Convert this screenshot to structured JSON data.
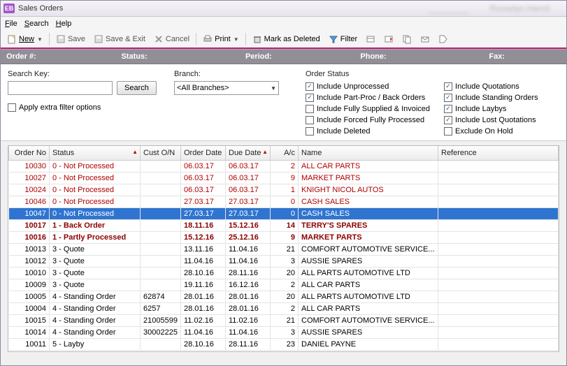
{
  "title": "Sales Orders",
  "blurred1": "________",
  "blurred2": "Russelyn Harrol",
  "menu": {
    "file": "File",
    "search": "Search",
    "help": "Help"
  },
  "toolbar": {
    "new": "New",
    "save": "Save",
    "saveexit": "Save & Exit",
    "cancel": "Cancel",
    "print": "Print",
    "markdel": "Mark as Deleted",
    "filter": "Filter"
  },
  "infobar": {
    "order": "Order #:",
    "status": "Status:",
    "period": "Period:",
    "phone": "Phone:",
    "fax": "Fax:"
  },
  "filters": {
    "searchkey_lbl": "Search Key:",
    "search_btn": "Search",
    "extra_lbl": "Apply extra filter options",
    "branch_lbl": "Branch:",
    "branch_val": "<All Branches>",
    "os_lbl": "Order Status",
    "os": [
      {
        "label": "Include Unprocessed",
        "checked": true
      },
      {
        "label": "Include Part-Proc / Back Orders",
        "checked": true
      },
      {
        "label": "Include Fully Supplied & Invoiced",
        "checked": false
      },
      {
        "label": "Include Forced Fully Processed",
        "checked": false
      },
      {
        "label": "Include Deleted",
        "checked": false
      }
    ],
    "os2": [
      {
        "label": "Include Quotations",
        "checked": true
      },
      {
        "label": "Include Standing Orders",
        "checked": true
      },
      {
        "label": "Include Laybys",
        "checked": true
      },
      {
        "label": "Include Lost Quotations",
        "checked": true
      },
      {
        "label": "Exclude On Hold",
        "checked": false
      }
    ]
  },
  "cols": {
    "orderno": "Order No",
    "status": "Status",
    "con": "Cust O/N",
    "od": "Order Date",
    "dd": "Due Date",
    "ac": "A/c",
    "name": "Name",
    "ref": "Reference"
  },
  "rows": [
    {
      "no": "10030",
      "st": "0 - Not Processed",
      "con": "",
      "od": "06.03.17",
      "dd": "06.03.17",
      "ac": "2",
      "nm": "ALL CAR PARTS",
      "cls": "red"
    },
    {
      "no": "10027",
      "st": "0 - Not Processed",
      "con": "",
      "od": "06.03.17",
      "dd": "06.03.17",
      "ac": "9",
      "nm": "MARKET PARTS",
      "cls": "red"
    },
    {
      "no": "10024",
      "st": "0 - Not Processed",
      "con": "",
      "od": "06.03.17",
      "dd": "06.03.17",
      "ac": "1",
      "nm": "KNIGHT NICOL AUTOS",
      "cls": "red"
    },
    {
      "no": "10046",
      "st": "0 - Not Processed",
      "con": "",
      "od": "27.03.17",
      "dd": "27.03.17",
      "ac": "0",
      "nm": "CASH SALES",
      "cls": "red"
    },
    {
      "no": "10047",
      "st": "0 - Not Processed",
      "con": "",
      "od": "27.03.17",
      "dd": "27.03.17",
      "ac": "0",
      "nm": "CASH SALES",
      "cls": "red sel"
    },
    {
      "no": "10017",
      "st": "1 - Back Order",
      "con": "",
      "od": "18.11.16",
      "dd": "15.12.16",
      "ac": "14",
      "nm": "TERRY'S SPARES",
      "cls": "bold"
    },
    {
      "no": "10016",
      "st": "1 - Partly Processed",
      "con": "",
      "od": "15.12.16",
      "dd": "25.12.16",
      "ac": "9",
      "nm": "MARKET PARTS",
      "cls": "bold"
    },
    {
      "no": "10013",
      "st": "3 - Quote",
      "con": "",
      "od": "13.11.16",
      "dd": "11.04.16",
      "ac": "21",
      "nm": "COMFORT AUTOMOTIVE SERVICE...",
      "cls": ""
    },
    {
      "no": "10012",
      "st": "3 - Quote",
      "con": "",
      "od": "11.04.16",
      "dd": "11.04.16",
      "ac": "3",
      "nm": "AUSSIE SPARES",
      "cls": ""
    },
    {
      "no": "10010",
      "st": "3 - Quote",
      "con": "",
      "od": "28.10.16",
      "dd": "28.11.16",
      "ac": "20",
      "nm": "ALL PARTS AUTOMOTIVE LTD",
      "cls": ""
    },
    {
      "no": "10009",
      "st": "3 - Quote",
      "con": "",
      "od": "19.11.16",
      "dd": "16.12.16",
      "ac": "2",
      "nm": "ALL CAR PARTS",
      "cls": ""
    },
    {
      "no": "10005",
      "st": "4 - Standing Order",
      "con": "62874",
      "od": "28.01.16",
      "dd": "28.01.16",
      "ac": "20",
      "nm": "ALL PARTS AUTOMOTIVE LTD",
      "cls": ""
    },
    {
      "no": "10004",
      "st": "4 - Standing Order",
      "con": "6257",
      "od": "28.01.16",
      "dd": "28.01.16",
      "ac": "2",
      "nm": "ALL CAR PARTS",
      "cls": ""
    },
    {
      "no": "10015",
      "st": "4 - Standing Order",
      "con": "21005599",
      "od": "11.02.16",
      "dd": "11.02.16",
      "ac": "21",
      "nm": "COMFORT AUTOMOTIVE SERVICE...",
      "cls": ""
    },
    {
      "no": "10014",
      "st": "4 - Standing Order",
      "con": "30002225",
      "od": "11.04.16",
      "dd": "11.04.16",
      "ac": "3",
      "nm": "AUSSIE SPARES",
      "cls": ""
    },
    {
      "no": "10011",
      "st": "5 - Layby",
      "con": "",
      "od": "28.10.16",
      "dd": "28.11.16",
      "ac": "23",
      "nm": "DANIEL PAYNE",
      "cls": ""
    }
  ]
}
